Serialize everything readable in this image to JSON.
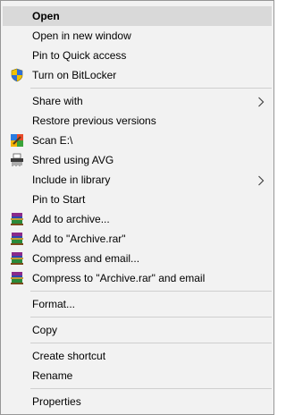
{
  "menu": {
    "items": [
      {
        "label": "Open"
      },
      {
        "label": "Open in new window"
      },
      {
        "label": "Pin to Quick access"
      },
      {
        "label": "Turn on BitLocker",
        "icon": "shield-icon"
      },
      {
        "label": "Share with"
      },
      {
        "label": "Restore previous versions"
      },
      {
        "label": "Scan E:\\",
        "icon": "avg-scan-icon"
      },
      {
        "label": "Shred using AVG",
        "icon": "shredder-icon"
      },
      {
        "label": "Include in library"
      },
      {
        "label": "Pin to Start"
      },
      {
        "label": "Add to archive...",
        "icon": "winrar-icon"
      },
      {
        "label": "Add to \"Archive.rar\"",
        "icon": "winrar-icon"
      },
      {
        "label": "Compress and email...",
        "icon": "winrar-icon"
      },
      {
        "label": "Compress to \"Archive.rar\" and email",
        "icon": "winrar-icon"
      },
      {
        "label": "Format..."
      },
      {
        "label": "Copy"
      },
      {
        "label": "Create shortcut"
      },
      {
        "label": "Rename"
      },
      {
        "label": "Properties"
      }
    ],
    "highlighted_item": "Open",
    "colors": {
      "background": "#f2f2f2",
      "highlight": "#d9d9d9",
      "separator": "#cfcfcf",
      "border": "#979797"
    }
  }
}
